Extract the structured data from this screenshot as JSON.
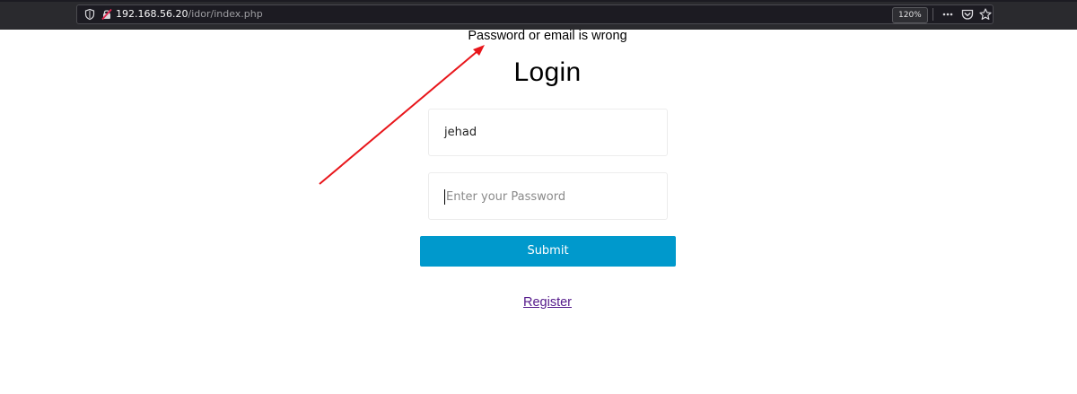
{
  "browser": {
    "url_host": "192.168.56.20",
    "url_path": "/idor/index.php",
    "zoom": "120%",
    "icons": [
      "shield-icon",
      "insecure-lock-icon",
      "more-icon",
      "pocket-icon",
      "bookmark-star-icon"
    ]
  },
  "page": {
    "error_message": "Password or email is wrong",
    "title": "Login",
    "username_value": "jehad",
    "password_placeholder": "Enter your Password",
    "submit_label": "Submit",
    "register_label": "Register"
  },
  "colors": {
    "submit_bg": "#0099cc",
    "annotation_arrow": "#e8161b",
    "link": "#551a8b",
    "chrome_bg": "#2a2a2e"
  }
}
